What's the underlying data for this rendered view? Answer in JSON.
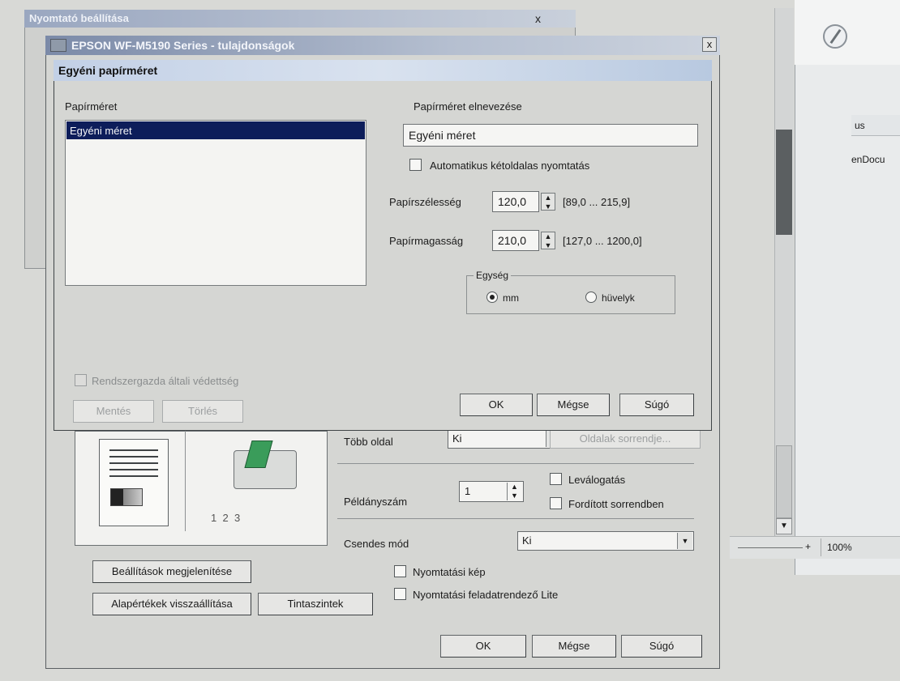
{
  "background": {
    "right_panel_header": "us",
    "right_panel_doc": "enDocu",
    "zoom_plus": "+",
    "zoom": "100%",
    "scroll_down": "▼"
  },
  "printer_settings_window": {
    "title": "Nyomtató beállítása",
    "close": "x"
  },
  "properties_dialog": {
    "title": "EPSON WF-M5190 Series - tulajdonságok",
    "close": "x"
  },
  "custom_paper_dialog": {
    "title": "Egyéni papírméret",
    "paper_size_label": "Papírméret",
    "paper_size_items": [
      "Egyéni méret"
    ],
    "paper_name_label": "Papírméret elnevezése",
    "paper_name_value": "Egyéni méret",
    "auto_duplex_label": "Automatikus kétoldalas nyomtatás",
    "width_label": "Papírszélesség",
    "width_value": "120,0",
    "width_range": "[89,0 ... 215,9]",
    "height_label": "Papírmagasság",
    "height_value": "210,0",
    "height_range": "[127,0 ... 1200,0]",
    "unit_label": "Egység",
    "unit_mm": "mm",
    "unit_inch": "hüvelyk",
    "unit_selected": "mm",
    "admin_protect_label": "Rendszergazda általi védettség",
    "save_button": "Mentés",
    "delete_button": "Törlés",
    "ok_button": "OK",
    "cancel_button": "Mégse",
    "help_button": "Súgó"
  },
  "main_page": {
    "multi_page_label": "Több oldal",
    "multi_page_value": "Ki",
    "page_order_button": "Oldalak sorrendje...",
    "copies_label": "Példányszám",
    "copies_value": "1",
    "collate_label": "Leválogatás",
    "reverse_label": "Fordított sorrendben",
    "quiet_mode_label": "Csendes mód",
    "quiet_mode_value": "Ki",
    "show_settings_button": "Beállítások megjelenítése",
    "restore_defaults_button": "Alapértékek visszaállítása",
    "ink_levels_button": "Tintaszintek",
    "print_preview_label": "Nyomtatási kép",
    "job_arranger_label": "Nyomtatási feladatrendező Lite",
    "collate_icon_labels": [
      "1",
      "2",
      "3"
    ],
    "ok_button": "OK",
    "cancel_button": "Mégse",
    "help_button": "Súgó"
  },
  "colors": {
    "selection": "#0d1d5a",
    "dialog_face": "#d5d6d3",
    "title_gradient_start": "#7b8aa8"
  }
}
